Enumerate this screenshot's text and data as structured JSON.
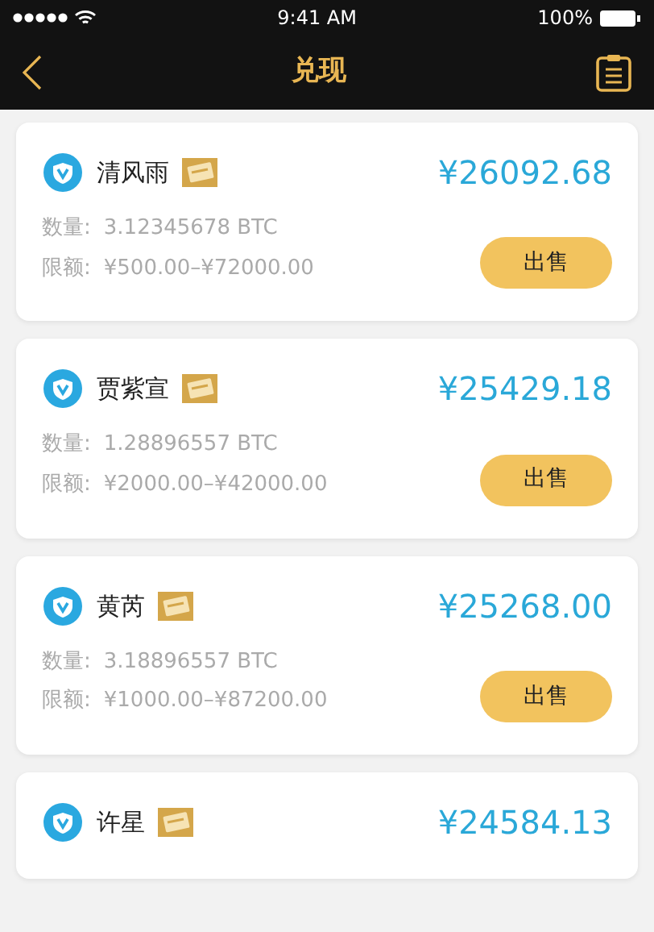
{
  "status_bar": {
    "time": "9:41 AM",
    "battery": "100%"
  },
  "nav": {
    "title": "兑现"
  },
  "offers": [
    {
      "name": "清风雨",
      "price": "¥26092.68",
      "amount_label": "数量:",
      "amount": "3.12345678 BTC",
      "limit_label": "限额:",
      "limit": "¥500.00–¥72000.00",
      "action": "出售"
    },
    {
      "name": "贾紫宣",
      "price": "¥25429.18",
      "amount_label": "数量:",
      "amount": "1.28896557 BTC",
      "limit_label": "限额:",
      "limit": "¥2000.00–¥42000.00",
      "action": "出售"
    },
    {
      "name": "黄芮",
      "price": "¥25268.00",
      "amount_label": "数量:",
      "amount": "3.18896557 BTC",
      "limit_label": "限额:",
      "limit": "¥1000.00–¥87200.00",
      "action": "出售"
    },
    {
      "name": "许星",
      "price": "¥24584.13"
    }
  ]
}
